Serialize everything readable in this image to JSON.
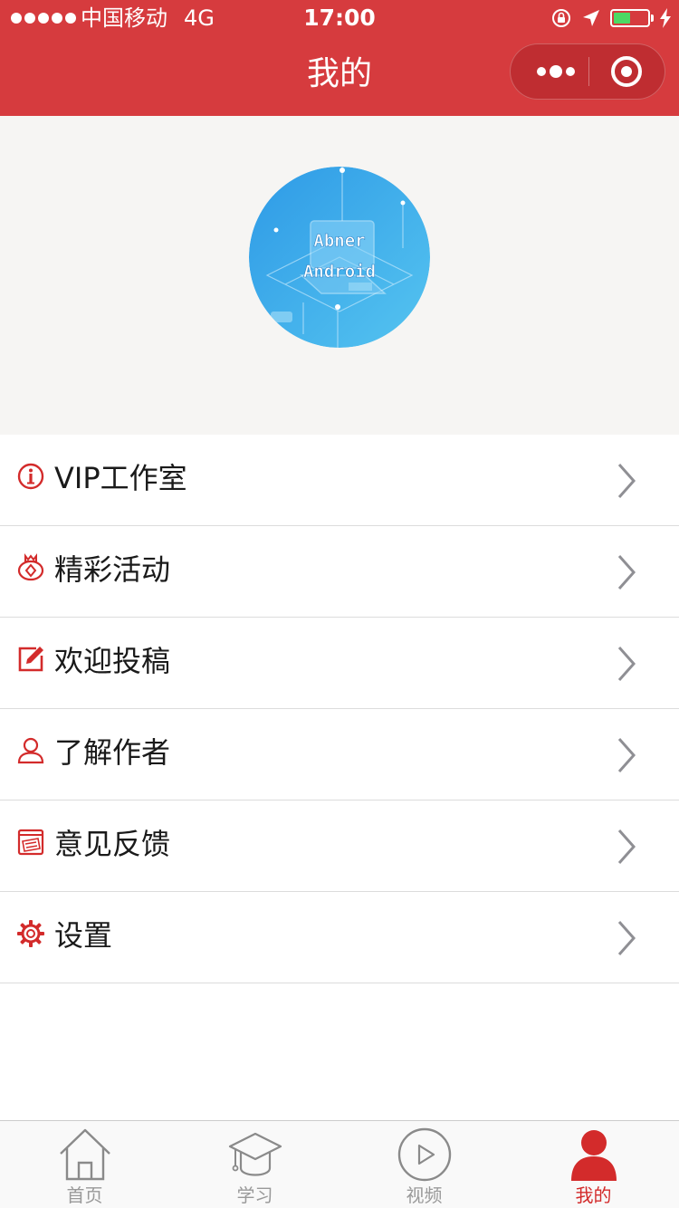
{
  "status_bar": {
    "carrier": "中国移动",
    "network": "4G",
    "time": "17:00",
    "battery_level": 0.5
  },
  "nav": {
    "title": "我的"
  },
  "profile": {
    "avatar_text_line1": "Abner",
    "avatar_text_line2": "Android"
  },
  "menu": [
    {
      "label": "VIP工作室",
      "icon": "info-icon"
    },
    {
      "label": "精彩活动",
      "icon": "gift-icon"
    },
    {
      "label": "欢迎投稿",
      "icon": "edit-icon"
    },
    {
      "label": "了解作者",
      "icon": "user-icon"
    },
    {
      "label": "意见反馈",
      "icon": "feedback-icon"
    },
    {
      "label": "设置",
      "icon": "gear-icon"
    }
  ],
  "tabs": [
    {
      "label": "首页",
      "icon": "home-icon",
      "active": false
    },
    {
      "label": "学习",
      "icon": "graduation-cap-icon",
      "active": false
    },
    {
      "label": "视频",
      "icon": "play-icon",
      "active": false
    },
    {
      "label": "我的",
      "icon": "person-icon",
      "active": true
    }
  ],
  "colors": {
    "brand_red": "#d63b3e",
    "icon_red": "#d32b2b",
    "tab_inactive": "#999999",
    "battery_green": "#4cd964",
    "header_bg": "#f6f5f3"
  }
}
